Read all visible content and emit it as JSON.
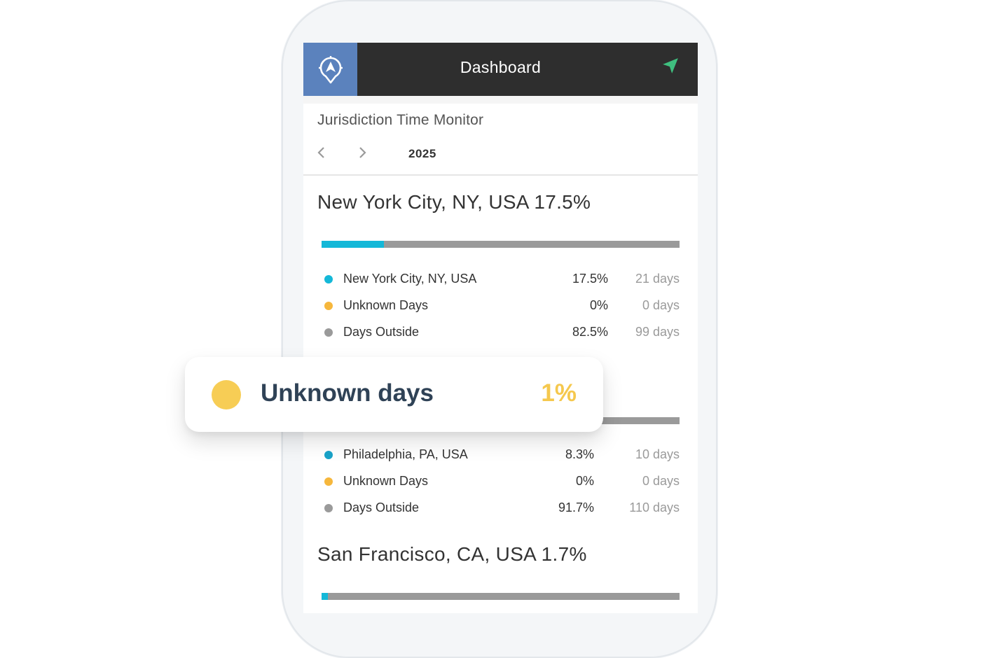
{
  "colors": {
    "city_primary": "#14b8d8",
    "city_secondary": "#1aa3c9",
    "unknown": "#f6b73c",
    "outside": "#9a9a9a",
    "popup_dot": "#f7cd55",
    "popup_pct": "#f5c84e",
    "header_logo_bg": "#5b82bd",
    "nav_arrow": "#3fbf7f"
  },
  "header": {
    "title": "Dashboard",
    "logo_icon": "compass-pin-icon",
    "action_icon": "navigation-arrow-icon"
  },
  "monitor": {
    "title": "Jurisdiction Time Monitor",
    "prev_icon": "chevron-left-icon",
    "next_icon": "chevron-right-icon",
    "year": "2025"
  },
  "locations": [
    {
      "title": "New York City, NY, USA 17.5%",
      "share": 0.175,
      "rows": [
        {
          "label": "New York City, NY, USA",
          "pct": "17.5%",
          "days": "21 days"
        },
        {
          "label": "Unknown Days",
          "pct": "0%",
          "days": "0 days"
        },
        {
          "label": "Days Outside",
          "pct": "82.5%",
          "days": "99 days"
        }
      ]
    },
    {
      "title": "",
      "share": 0.083,
      "rows": [
        {
          "label": "Philadelphia, PA, USA",
          "pct": "8.3%",
          "days": "10 days"
        },
        {
          "label": "Unknown Days",
          "pct": "0%",
          "days": "0 days"
        },
        {
          "label": "Days Outside",
          "pct": "91.7%",
          "days": "110 days"
        }
      ]
    },
    {
      "title": "San Francisco, CA, USA 1.7%",
      "share": 0.017
    }
  ],
  "popup": {
    "label": "Unknown days",
    "pct": "1%"
  }
}
